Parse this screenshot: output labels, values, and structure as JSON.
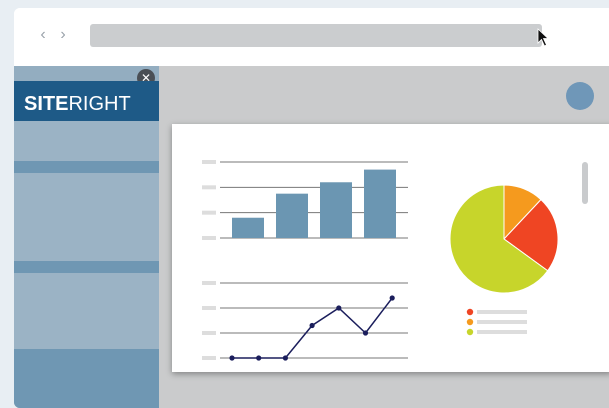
{
  "brand": {
    "name_bold": "SITE",
    "name_light": "RIGHT"
  },
  "colors": {
    "bar": "#6b96b2",
    "line": "#1b1e5c",
    "pie_green": "#c7d52b",
    "pie_red": "#ef4523",
    "pie_orange": "#f59a1e",
    "sidebar": "#93adc0",
    "logo_bg": "#1e5a87"
  },
  "icons": {
    "back": "chevron-left-icon",
    "forward": "chevron-right-icon",
    "close": "close-icon",
    "avatar": "avatar-icon",
    "cursor": "mouse-pointer-icon"
  },
  "chart_data": [
    {
      "type": "bar",
      "categories": [
        "",
        "",
        "",
        ""
      ],
      "values": [
        0.8,
        1.75,
        2.2,
        2.7
      ],
      "ylim": [
        0,
        3
      ],
      "grid": true
    },
    {
      "type": "line",
      "x": [
        0,
        1,
        2,
        3,
        4,
        5,
        6,
        7
      ],
      "values": [
        0,
        0,
        0,
        1.3,
        2.0,
        1.0,
        2.4,
        0
      ],
      "points_used": 7,
      "ylim": [
        0,
        3
      ],
      "grid": true
    },
    {
      "type": "pie",
      "slices": [
        {
          "value": 12,
          "color": "#f59a1e"
        },
        {
          "value": 23,
          "color": "#ef4523"
        },
        {
          "value": 65,
          "color": "#c7d52b"
        }
      ],
      "legend_position": "bottom"
    }
  ]
}
